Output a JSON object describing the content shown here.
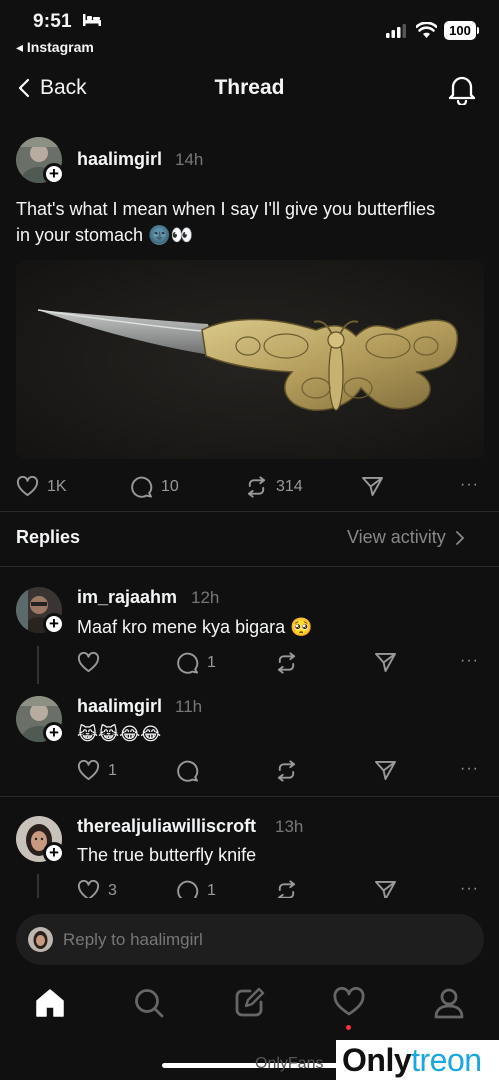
{
  "status_bar": {
    "time": "9:51",
    "back_app": "◂ Instagram",
    "battery": "100"
  },
  "nav": {
    "back_label": "Back",
    "title": "Thread"
  },
  "post": {
    "username": "haalimgirl",
    "time": "14h",
    "text_line1": "That's what I mean when I say I'll give you butterflies",
    "text_line2": "in your stomach 🌚👀",
    "likes": "1K",
    "comments": "10",
    "reposts": "314"
  },
  "replies_header": {
    "label": "Replies",
    "view_activity": "View activity"
  },
  "replies": [
    {
      "username": "im_rajaahm",
      "time": "12h",
      "text": "Maaf kro mene kya bigara 🥺",
      "likes": "",
      "comments": "1"
    },
    {
      "username": "haalimgirl",
      "time": "11h",
      "text": "😹😹😂😂",
      "likes": "1",
      "comments": ""
    },
    {
      "username": "therealjuliawilliscroft",
      "time": "13h",
      "text": "The true butterfly knife",
      "likes": "3",
      "comments": "1"
    }
  ],
  "reply_box": {
    "placeholder": "Reply to haalimgirl"
  },
  "watermark": {
    "faint": "OnlyFans",
    "brand_a": "Only",
    "brand_b": "treon"
  },
  "colors": {
    "background": "#101010",
    "text": "#f3f5f7",
    "muted": "#777777",
    "notification_dot": "#ff3040"
  },
  "icons": [
    "bed-icon",
    "signal-icon",
    "wifi-icon",
    "battery-icon",
    "back-chevron-icon",
    "bell-icon",
    "heart-icon",
    "comment-icon",
    "repost-icon",
    "share-icon",
    "more-icon",
    "chevron-right-icon",
    "home-icon",
    "search-icon",
    "compose-icon",
    "activity-icon",
    "profile-icon"
  ]
}
